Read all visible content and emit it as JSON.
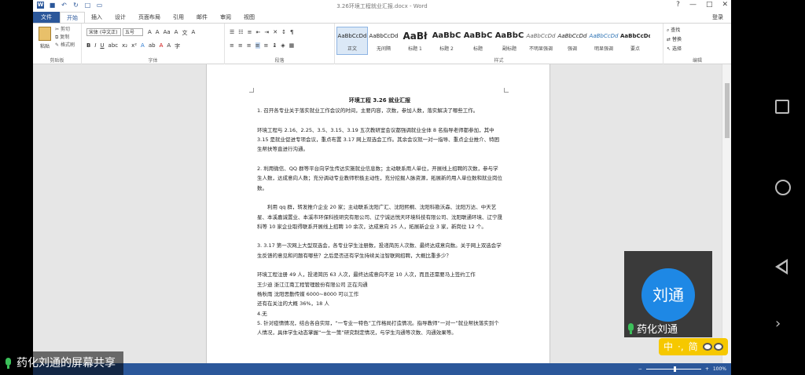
{
  "window": {
    "title": "3.26环境工程就业汇报.docx - Word",
    "controls": [
      "?",
      "—",
      "□",
      "✕"
    ]
  },
  "tabs": [
    "文件",
    "开始",
    "插入",
    "设计",
    "页面布局",
    "引用",
    "邮件",
    "审阅",
    "视图"
  ],
  "login": "登录",
  "ribbon": {
    "clipboard": {
      "paste": "粘贴",
      "cut": "剪切",
      "copy": "复制",
      "format_painter": "格式刷",
      "label": "剪贴板"
    },
    "font": {
      "name": "宋体 (中文正)",
      "size": "五号",
      "label": "字体"
    },
    "paragraph": {
      "label": "段落"
    },
    "styles": {
      "label": "样式",
      "items": [
        {
          "preview": "AaBbCcDd",
          "name": "正文"
        },
        {
          "preview": "AaBbCcDd",
          "name": "无间隔"
        },
        {
          "preview": "AaBł",
          "name": "标题 1"
        },
        {
          "preview": "AaBbC",
          "name": "标题 2"
        },
        {
          "preview": "AaBbC",
          "name": "标题"
        },
        {
          "preview": "AaBbC",
          "name": "副标题"
        },
        {
          "preview": "AaBbCcDd",
          "name": "不明显强调"
        },
        {
          "preview": "AaBbCcDd",
          "name": "强调"
        },
        {
          "preview": "AaBbCcDd",
          "name": "明显强调"
        },
        {
          "preview": "AaBbCcDd",
          "name": "要点"
        }
      ]
    },
    "editing": {
      "find": "查找",
      "replace": "替换",
      "select": "选择",
      "label": "编辑"
    }
  },
  "document": {
    "title": "环境工程 3.26 就业汇报",
    "paragraphs": [
      "1. 召开各专业关于落实就业工作会议的时间，主要内容，次数，参加人数，落实解决了哪些工作。",
      "",
      "环境工程与 2.16、2.25、3.5、3.15、3.19 五次教研室会议都强调就业全体 8 名指导老师都参加，其中 3.15 是就业促进专项会议，重点布置 3.17 网上双选会工作。其余会议就一对一指导、重点企业推介、特困生帮扶等直进行沟通。",
      "",
      "2. 利用微信、QQ 群等平台向学生传达实施就业信息数；主动联系用人单位，开展线上招聘的次数，参与学生人数，达成意向人数；充分调动专业教师积极主动性，充分挖掘人脉资源，拓展新的用人单位数和就业岗位数。",
      "",
      "利用 qq 群，转发推介企业 20 家；主动联系沈阳广汇、沈阳熙桐、沈阳科勘沃森、沈阳万达、中天艺星、本溪嘉诚置业、本溪市环保科技研究有限公司、辽宁诚达悦天环境科技有限公司、沈阳联通环境、辽宁晟科等 10 家企业取得联系开展线上招聘 10 余次，达成意向 25 人，拓展新企业 3 家，新岗位 12 个。",
      "",
      "3. 3.17 第一次网上大型双选会，各专业学生注册数，投递简历人次数、最终达成意向数。关于网上双选会学生反馈的意见和问题有哪些？之后是否还有学生持续关注智联网招聘，大概比重多少？",
      "",
      "环境工程注册 49 人，投递简历 63 人次，最终达成意向不足 10 人次，而且还需要马上签约工作",
      "王少迪  浙江江南工程管理股份有限公司  正在沟通",
      "杨秋雨  沈阳思勤传媒       6000~8000        可以工作",
      "还有在关注的大概 36%，18 人",
      "4.无",
      "5. 针对疫情情况，结合各自实际，“一专业一特色”工作格局打造情况。指导教师“一对一”就业帮扶落实到个人情况，具体学生动态掌握“一生一策”研究制定情况，与学生沟通等次数、沟通效果等。"
    ]
  },
  "statusbar": {
    "zoom": "100%"
  },
  "overlays": {
    "screen_share": "药化刘通的屏幕共享",
    "presenter_avatar": "刘通",
    "presenter_name": "药化刘通",
    "ime_mode": "中",
    "ime_punct": "·,",
    "ime_simp": "简"
  },
  "colors": {
    "word_blue": "#2b579a",
    "avatar_blue": "#1e88e5",
    "mic_green": "#3cc05a",
    "ime_yellow": "#f6c800"
  }
}
